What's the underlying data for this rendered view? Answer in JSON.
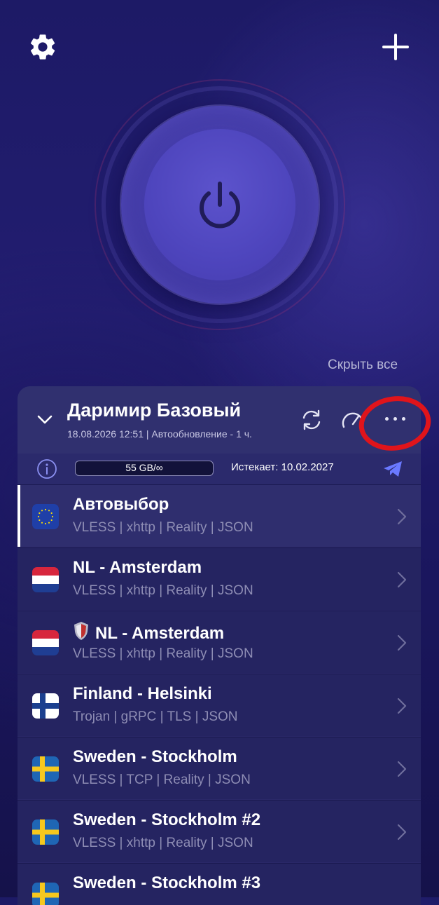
{
  "header": {
    "settings_icon": "gear-icon",
    "add_icon": "plus-icon"
  },
  "power": {
    "icon": "power-icon"
  },
  "hide_all_label": "Скрыть все",
  "subscription": {
    "title": "Даримир Базовый",
    "meta": "18.08.2026 12:51 | Автообновление - 1 ч.",
    "traffic": "55 GB/∞",
    "expires": "Истекает: 10.02.2027",
    "icons": [
      "refresh-icon",
      "speedometer-icon",
      "more-dots-icon",
      "info-icon",
      "telegram-icon"
    ]
  },
  "servers": [
    {
      "name": "Автовыбор",
      "protocol": "VLESS | xhttp | Reality | JSON",
      "flag": "eu",
      "active": true
    },
    {
      "name": "NL - Amsterdam",
      "protocol": "VLESS | xhttp | Reality | JSON",
      "flag": "nl"
    },
    {
      "name": "NL - Amsterdam",
      "protocol": "VLESS | xhttp | Reality | JSON",
      "flag": "nl",
      "badge": "shield-icon"
    },
    {
      "name": "Finland - Helsinki",
      "protocol": "Trojan | gRPC | TLS | JSON",
      "flag": "fi"
    },
    {
      "name": "Sweden - Stockholm",
      "protocol": "VLESS | TCP | Reality | JSON",
      "flag": "se"
    },
    {
      "name": "Sweden - Stockholm #2",
      "protocol": "VLESS | xhttp | Reality | JSON",
      "flag": "se"
    },
    {
      "name": "Sweden - Stockholm #3",
      "protocol": "",
      "flag": "se"
    }
  ],
  "colors": {
    "background": "#1d1a66",
    "panel": "#2a2868",
    "accent": "#6a79ff",
    "highlight_circle": "#e0141b"
  }
}
